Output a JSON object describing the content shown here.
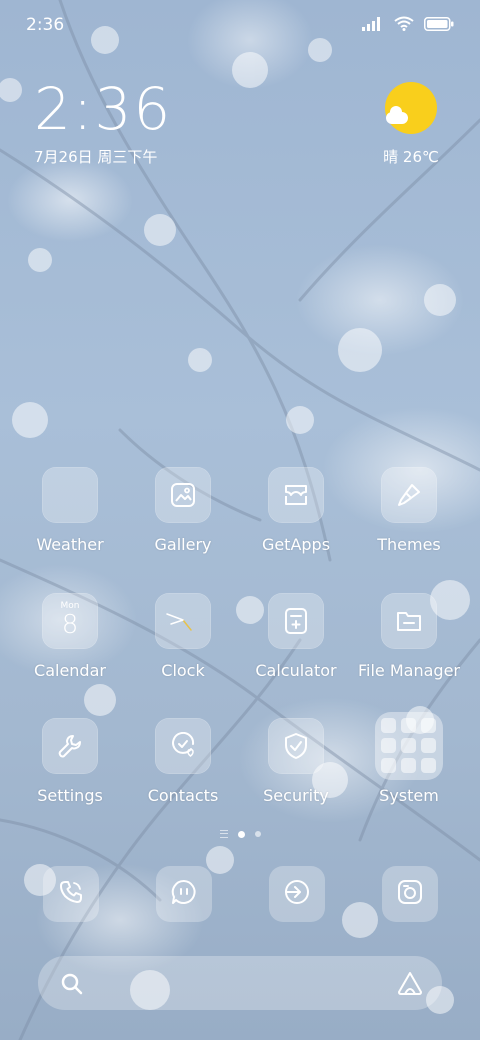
{
  "status_bar": {
    "time": "2:36"
  },
  "clock_widget": {
    "time": "2:36",
    "date": "7月26日 周三下午"
  },
  "weather_widget": {
    "condition_temp": "晴 26℃",
    "sun_color": "#f9cf1c"
  },
  "apps": [
    {
      "label": "Weather",
      "icon": "weather-icon"
    },
    {
      "label": "Gallery",
      "icon": "gallery-icon"
    },
    {
      "label": "GetApps",
      "icon": "getapps-icon"
    },
    {
      "label": "Themes",
      "icon": "themes-icon"
    },
    {
      "label": "Calendar",
      "icon": "calendar-icon",
      "day_of_week": "Mon",
      "day": "8"
    },
    {
      "label": "Clock",
      "icon": "clock-icon"
    },
    {
      "label": "Calculator",
      "icon": "calculator-icon"
    },
    {
      "label": "File Manager",
      "icon": "file-manager-icon"
    },
    {
      "label": "Settings",
      "icon": "settings-icon"
    },
    {
      "label": "Contacts",
      "icon": "contacts-icon"
    },
    {
      "label": "Security",
      "icon": "security-icon"
    },
    {
      "label": "System",
      "icon": "system-folder-icon"
    }
  ],
  "dock": [
    {
      "icon": "phone-icon"
    },
    {
      "icon": "messages-icon"
    },
    {
      "icon": "browser-icon"
    },
    {
      "icon": "camera-icon"
    }
  ],
  "page_indicator": {
    "pages": 2,
    "active": 1
  }
}
